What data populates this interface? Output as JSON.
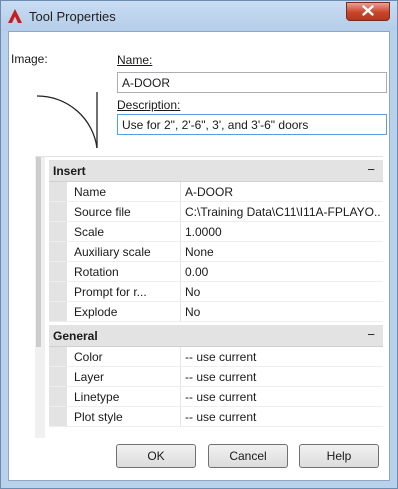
{
  "window": {
    "title": "Tool Properties"
  },
  "form": {
    "image_label": "Image:",
    "name_label": "Name:",
    "name_value": "A-DOOR",
    "description_label": "Description:",
    "description_value": "Use for 2\", 2'-6\", 3', and 3'-6\" doors"
  },
  "sections": [
    {
      "title": "Insert",
      "toggle": "−",
      "rows": [
        {
          "name": "Name",
          "value": "A-DOOR"
        },
        {
          "name": "Source file",
          "value": "C:\\Training Data\\C11\\I11A-FPLAYO..."
        },
        {
          "name": "Scale",
          "value": "1.0000"
        },
        {
          "name": "Auxiliary scale",
          "value": "None"
        },
        {
          "name": "Rotation",
          "value": "0.00"
        },
        {
          "name": "Prompt for r...",
          "value": "No"
        },
        {
          "name": "Explode",
          "value": "No"
        }
      ]
    },
    {
      "title": "General",
      "toggle": "−",
      "rows": [
        {
          "name": "Color",
          "value": "-- use current"
        },
        {
          "name": "Layer",
          "value": "-- use current"
        },
        {
          "name": "Linetype",
          "value": "-- use current"
        },
        {
          "name": "Plot style",
          "value": "-- use current"
        }
      ]
    }
  ],
  "buttons": {
    "ok": "OK",
    "cancel": "Cancel",
    "help": "Help"
  },
  "icons": {
    "app": "autocad-logo-icon",
    "close": "close-icon"
  },
  "colors": {
    "title_bar": "#b9d1ea",
    "close_button": "#c7452b",
    "app_icon": "#c41e1e",
    "section_header": "#e3e3e3"
  }
}
